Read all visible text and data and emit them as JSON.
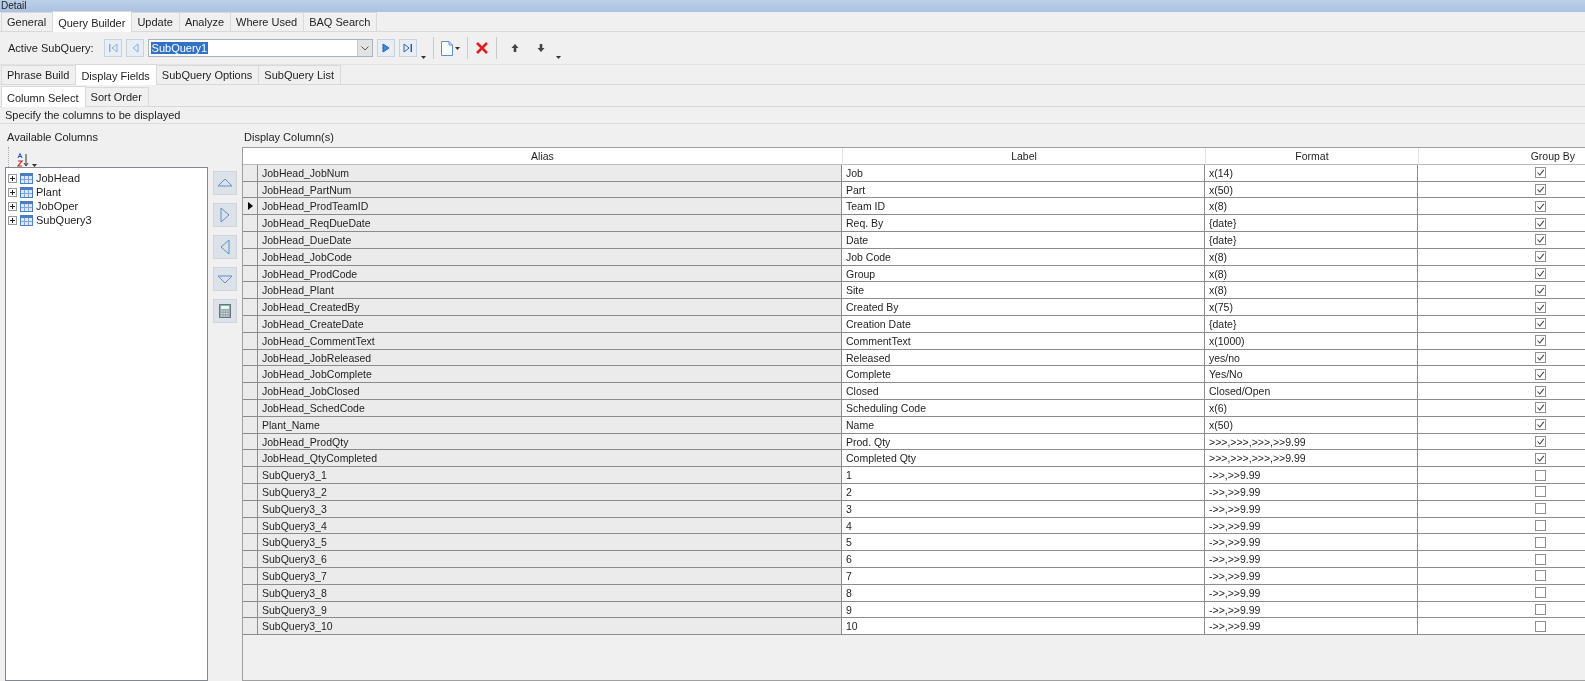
{
  "window": {
    "title": "Detail"
  },
  "tabs": [
    {
      "label": "General",
      "selected": false
    },
    {
      "label": "Query Builder",
      "selected": true
    },
    {
      "label": "Update",
      "selected": false
    },
    {
      "label": "Analyze",
      "selected": false
    },
    {
      "label": "Where Used",
      "selected": false
    },
    {
      "label": "BAQ Search",
      "selected": false
    }
  ],
  "toolbar": {
    "label": "Active SubQuery:",
    "subquery": "SubQuery1"
  },
  "subtabs": [
    {
      "label": "Phrase Build",
      "selected": false
    },
    {
      "label": "Display Fields",
      "selected": true
    },
    {
      "label": "SubQuery Options",
      "selected": false
    },
    {
      "label": "SubQuery List",
      "selected": false
    }
  ],
  "inner_tabs": [
    {
      "label": "Column Select",
      "selected": true
    },
    {
      "label": "Sort Order",
      "selected": false
    }
  ],
  "hint": "Specify the columns to be displayed",
  "available_columns": {
    "title": "Available Columns",
    "items": [
      {
        "label": "JobHead",
        "expanded": false
      },
      {
        "label": "Plant",
        "expanded": false
      },
      {
        "label": "JobOper",
        "expanded": false
      },
      {
        "label": "SubQuery3",
        "expanded": false
      }
    ]
  },
  "display_columns": {
    "title": "Display Column(s)",
    "columns": [
      "Alias",
      "Label",
      "Format",
      "Group By"
    ],
    "rows": [
      {
        "alias": "JobHead_JobNum",
        "label": "Job",
        "format": "x(14)",
        "group_by": true,
        "selected": false
      },
      {
        "alias": "JobHead_PartNum",
        "label": "Part",
        "format": "x(50)",
        "group_by": true,
        "selected": false
      },
      {
        "alias": "JobHead_ProdTeamID",
        "label": "Team ID",
        "format": "x(8)",
        "group_by": true,
        "selected": true
      },
      {
        "alias": "JobHead_ReqDueDate",
        "label": "Req. By",
        "format": "{date}",
        "group_by": true,
        "selected": false
      },
      {
        "alias": "JobHead_DueDate",
        "label": "Date",
        "format": "{date}",
        "group_by": true,
        "selected": false
      },
      {
        "alias": "JobHead_JobCode",
        "label": "Job Code",
        "format": "x(8)",
        "group_by": true,
        "selected": false
      },
      {
        "alias": "JobHead_ProdCode",
        "label": "Group",
        "format": "x(8)",
        "group_by": true,
        "selected": false
      },
      {
        "alias": "JobHead_Plant",
        "label": "Site",
        "format": "x(8)",
        "group_by": true,
        "selected": false
      },
      {
        "alias": "JobHead_CreatedBy",
        "label": "Created By",
        "format": "x(75)",
        "group_by": true,
        "selected": false
      },
      {
        "alias": "JobHead_CreateDate",
        "label": "Creation Date",
        "format": "{date}",
        "group_by": true,
        "selected": false
      },
      {
        "alias": "JobHead_CommentText",
        "label": "CommentText",
        "format": "x(1000)",
        "group_by": true,
        "selected": false
      },
      {
        "alias": "JobHead_JobReleased",
        "label": "Released",
        "format": "yes/no",
        "group_by": true,
        "selected": false
      },
      {
        "alias": "JobHead_JobComplete",
        "label": "Complete",
        "format": "Yes/No",
        "group_by": true,
        "selected": false
      },
      {
        "alias": "JobHead_JobClosed",
        "label": "Closed",
        "format": "Closed/Open",
        "group_by": true,
        "selected": false
      },
      {
        "alias": "JobHead_SchedCode",
        "label": "Scheduling Code",
        "format": "x(6)",
        "group_by": true,
        "selected": false
      },
      {
        "alias": "Plant_Name",
        "label": "Name",
        "format": "x(50)",
        "group_by": true,
        "selected": false
      },
      {
        "alias": "JobHead_ProdQty",
        "label": "Prod. Qty",
        "format": ">>>,>>>,>>>,>>9.99",
        "group_by": true,
        "selected": false
      },
      {
        "alias": "JobHead_QtyCompleted",
        "label": "Completed Qty",
        "format": ">>>,>>>,>>>,>>9.99",
        "group_by": true,
        "selected": false
      },
      {
        "alias": "SubQuery3_1",
        "label": "1",
        "format": "->>,>>9.99",
        "group_by": false,
        "selected": false
      },
      {
        "alias": "SubQuery3_2",
        "label": "2",
        "format": "->>,>>9.99",
        "group_by": false,
        "selected": false
      },
      {
        "alias": "SubQuery3_3",
        "label": "3",
        "format": "->>,>>9.99",
        "group_by": false,
        "selected": false
      },
      {
        "alias": "SubQuery3_4",
        "label": "4",
        "format": "->>,>>9.99",
        "group_by": false,
        "selected": false
      },
      {
        "alias": "SubQuery3_5",
        "label": "5",
        "format": "->>,>>9.99",
        "group_by": false,
        "selected": false
      },
      {
        "alias": "SubQuery3_6",
        "label": "6",
        "format": "->>,>>9.99",
        "group_by": false,
        "selected": false
      },
      {
        "alias": "SubQuery3_7",
        "label": "7",
        "format": "->>,>>9.99",
        "group_by": false,
        "selected": false
      },
      {
        "alias": "SubQuery3_8",
        "label": "8",
        "format": "->>,>>9.99",
        "group_by": false,
        "selected": false
      },
      {
        "alias": "SubQuery3_9",
        "label": "9",
        "format": "->>,>>9.99",
        "group_by": false,
        "selected": false
      },
      {
        "alias": "SubQuery3_10",
        "label": "10",
        "format": "->>,>>9.99",
        "group_by": false,
        "selected": false
      }
    ]
  }
}
